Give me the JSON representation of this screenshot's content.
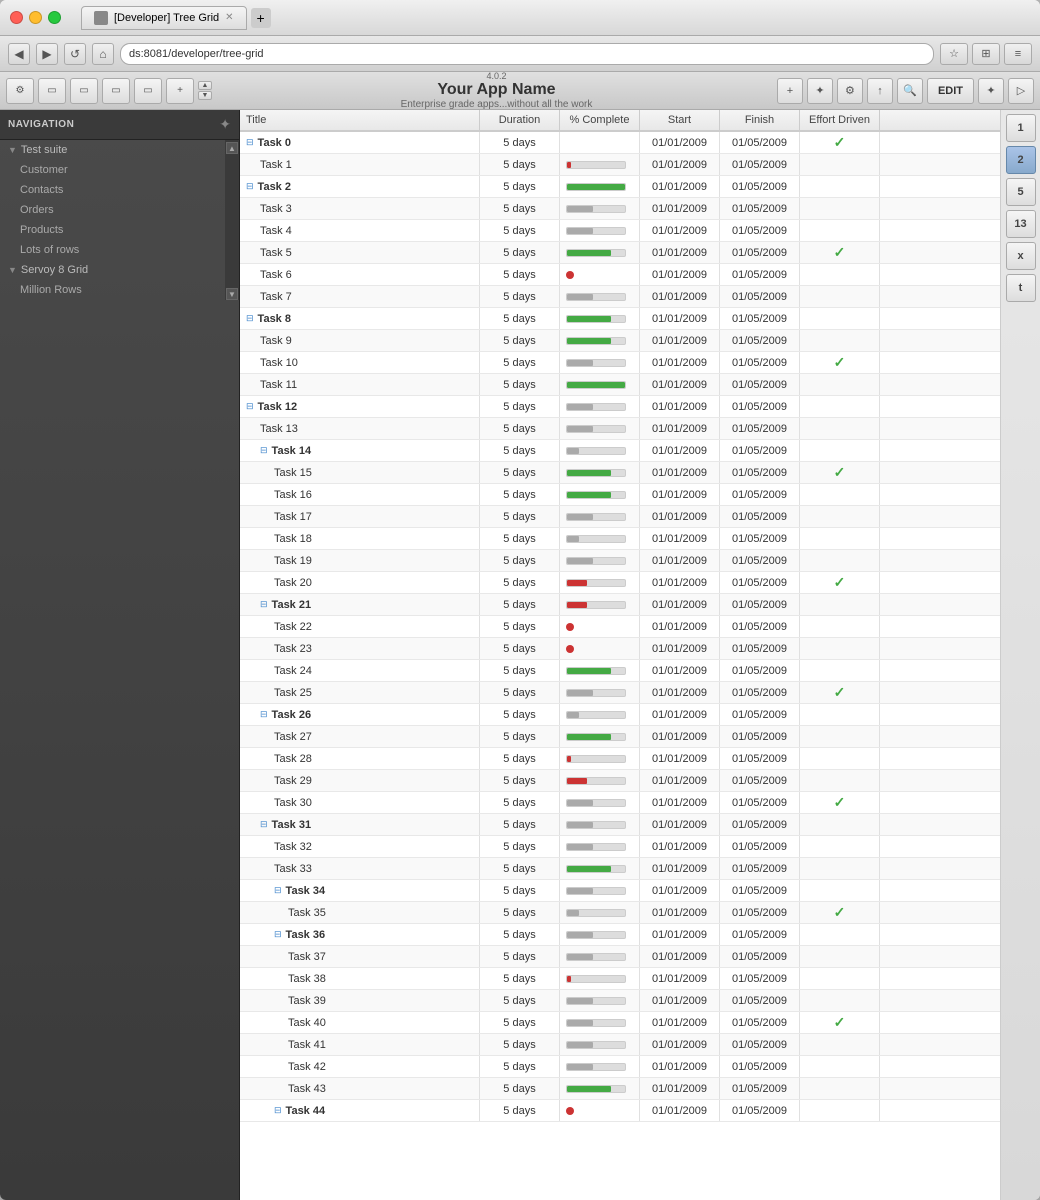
{
  "browser": {
    "tab_title": "[Developer] Tree Grid",
    "address": "ds:8081/developer/tree-grid",
    "new_tab_icon": "+"
  },
  "app": {
    "version": "4.0.2",
    "title": "Your App Name",
    "subtitle": "Enterprise grade apps...without all the work",
    "edit_button": "EDIT"
  },
  "nav": {
    "title": "NAVIGATION",
    "groups": [
      {
        "name": "Test suite",
        "items": [
          "Customer",
          "Contacts",
          "Orders",
          "Products",
          "Lots of rows"
        ]
      },
      {
        "name": "Servoy 8 Grid",
        "items": [
          "Million Rows"
        ]
      }
    ]
  },
  "grid": {
    "columns": [
      "Title",
      "Duration",
      "% Complete",
      "Start",
      "Finish",
      "Effort Driven"
    ],
    "rows": [
      {
        "title": "Task 0",
        "indent": 0,
        "expand": true,
        "duration": "5 days",
        "percent": "none",
        "start": "01/01/2009",
        "finish": "01/05/2009",
        "effort": "check"
      },
      {
        "title": "Task 1",
        "indent": 1,
        "expand": false,
        "duration": "5 days",
        "percent": "tiny-red",
        "start": "01/01/2009",
        "finish": "01/05/2009",
        "effort": ""
      },
      {
        "title": "Task 2",
        "indent": 0,
        "expand": true,
        "duration": "5 days",
        "percent": "full-green",
        "start": "01/01/2009",
        "finish": "01/05/2009",
        "effort": ""
      },
      {
        "title": "Task 3",
        "indent": 1,
        "expand": false,
        "duration": "5 days",
        "percent": "partial-gray",
        "start": "01/01/2009",
        "finish": "01/05/2009",
        "effort": ""
      },
      {
        "title": "Task 4",
        "indent": 1,
        "expand": false,
        "duration": "5 days",
        "percent": "partial-gray",
        "start": "01/01/2009",
        "finish": "01/05/2009",
        "effort": ""
      },
      {
        "title": "Task 5",
        "indent": 1,
        "expand": false,
        "duration": "5 days",
        "percent": "large-green",
        "start": "01/01/2009",
        "finish": "01/05/2009",
        "effort": "check"
      },
      {
        "title": "Task 6",
        "indent": 1,
        "expand": false,
        "duration": "5 days",
        "percent": "dot-red",
        "start": "01/01/2009",
        "finish": "01/05/2009",
        "effort": ""
      },
      {
        "title": "Task 7",
        "indent": 1,
        "expand": false,
        "duration": "5 days",
        "percent": "partial-gray",
        "start": "01/01/2009",
        "finish": "01/05/2009",
        "effort": ""
      },
      {
        "title": "Task 8",
        "indent": 0,
        "expand": true,
        "duration": "5 days",
        "percent": "large-green",
        "start": "01/01/2009",
        "finish": "01/05/2009",
        "effort": ""
      },
      {
        "title": "Task 9",
        "indent": 1,
        "expand": false,
        "duration": "5 days",
        "percent": "large-green",
        "start": "01/01/2009",
        "finish": "01/05/2009",
        "effort": ""
      },
      {
        "title": "Task 10",
        "indent": 1,
        "expand": false,
        "duration": "5 days",
        "percent": "partial-gray",
        "start": "01/01/2009",
        "finish": "01/05/2009",
        "effort": "check"
      },
      {
        "title": "Task 11",
        "indent": 1,
        "expand": false,
        "duration": "5 days",
        "percent": "full-green",
        "start": "01/01/2009",
        "finish": "01/05/2009",
        "effort": ""
      },
      {
        "title": "Task 12",
        "indent": 0,
        "expand": true,
        "duration": "5 days",
        "percent": "partial-gray",
        "start": "01/01/2009",
        "finish": "01/05/2009",
        "effort": ""
      },
      {
        "title": "Task 13",
        "indent": 1,
        "expand": false,
        "duration": "5 days",
        "percent": "partial-gray",
        "start": "01/01/2009",
        "finish": "01/05/2009",
        "effort": ""
      },
      {
        "title": "Task 14",
        "indent": 1,
        "expand": true,
        "duration": "5 days",
        "percent": "small-gray",
        "start": "01/01/2009",
        "finish": "01/05/2009",
        "effort": ""
      },
      {
        "title": "Task 15",
        "indent": 2,
        "expand": false,
        "duration": "5 days",
        "percent": "large-green",
        "start": "01/01/2009",
        "finish": "01/05/2009",
        "effort": "check"
      },
      {
        "title": "Task 16",
        "indent": 2,
        "expand": false,
        "duration": "5 days",
        "percent": "large-green",
        "start": "01/01/2009",
        "finish": "01/05/2009",
        "effort": ""
      },
      {
        "title": "Task 17",
        "indent": 2,
        "expand": false,
        "duration": "5 days",
        "percent": "partial-gray",
        "start": "01/01/2009",
        "finish": "01/05/2009",
        "effort": ""
      },
      {
        "title": "Task 18",
        "indent": 2,
        "expand": false,
        "duration": "5 days",
        "percent": "small-gray",
        "start": "01/01/2009",
        "finish": "01/05/2009",
        "effort": ""
      },
      {
        "title": "Task 19",
        "indent": 2,
        "expand": false,
        "duration": "5 days",
        "percent": "partial-gray",
        "start": "01/01/2009",
        "finish": "01/05/2009",
        "effort": ""
      },
      {
        "title": "Task 20",
        "indent": 2,
        "expand": false,
        "duration": "5 days",
        "percent": "medium-red",
        "start": "01/01/2009",
        "finish": "01/05/2009",
        "effort": "check"
      },
      {
        "title": "Task 21",
        "indent": 1,
        "expand": true,
        "duration": "5 days",
        "percent": "medium-red",
        "start": "01/01/2009",
        "finish": "01/05/2009",
        "effort": ""
      },
      {
        "title": "Task 22",
        "indent": 2,
        "expand": false,
        "duration": "5 days",
        "percent": "dot-red",
        "start": "01/01/2009",
        "finish": "01/05/2009",
        "effort": ""
      },
      {
        "title": "Task 23",
        "indent": 2,
        "expand": false,
        "duration": "5 days",
        "percent": "dot-red",
        "start": "01/01/2009",
        "finish": "01/05/2009",
        "effort": ""
      },
      {
        "title": "Task 24",
        "indent": 2,
        "expand": false,
        "duration": "5 days",
        "percent": "large-green",
        "start": "01/01/2009",
        "finish": "01/05/2009",
        "effort": ""
      },
      {
        "title": "Task 25",
        "indent": 2,
        "expand": false,
        "duration": "5 days",
        "percent": "partial-gray",
        "start": "01/01/2009",
        "finish": "01/05/2009",
        "effort": "check"
      },
      {
        "title": "Task 26",
        "indent": 1,
        "expand": true,
        "duration": "5 days",
        "percent": "small-gray",
        "start": "01/01/2009",
        "finish": "01/05/2009",
        "effort": ""
      },
      {
        "title": "Task 27",
        "indent": 2,
        "expand": false,
        "duration": "5 days",
        "percent": "large-green",
        "start": "01/01/2009",
        "finish": "01/05/2009",
        "effort": ""
      },
      {
        "title": "Task 28",
        "indent": 2,
        "expand": false,
        "duration": "5 days",
        "percent": "tiny-red",
        "start": "01/01/2009",
        "finish": "01/05/2009",
        "effort": ""
      },
      {
        "title": "Task 29",
        "indent": 2,
        "expand": false,
        "duration": "5 days",
        "percent": "medium-red",
        "start": "01/01/2009",
        "finish": "01/05/2009",
        "effort": ""
      },
      {
        "title": "Task 30",
        "indent": 2,
        "expand": false,
        "duration": "5 days",
        "percent": "partial-gray",
        "start": "01/01/2009",
        "finish": "01/05/2009",
        "effort": "check"
      },
      {
        "title": "Task 31",
        "indent": 1,
        "expand": true,
        "duration": "5 days",
        "percent": "partial-gray",
        "start": "01/01/2009",
        "finish": "01/05/2009",
        "effort": ""
      },
      {
        "title": "Task 32",
        "indent": 2,
        "expand": false,
        "duration": "5 days",
        "percent": "partial-gray",
        "start": "01/01/2009",
        "finish": "01/05/2009",
        "effort": ""
      },
      {
        "title": "Task 33",
        "indent": 2,
        "expand": false,
        "duration": "5 days",
        "percent": "large-green",
        "start": "01/01/2009",
        "finish": "01/05/2009",
        "effort": ""
      },
      {
        "title": "Task 34",
        "indent": 2,
        "expand": true,
        "duration": "5 days",
        "percent": "partial-gray",
        "start": "01/01/2009",
        "finish": "01/05/2009",
        "effort": ""
      },
      {
        "title": "Task 35",
        "indent": 3,
        "expand": false,
        "duration": "5 days",
        "percent": "small-gray",
        "start": "01/01/2009",
        "finish": "01/05/2009",
        "effort": "check"
      },
      {
        "title": "Task 36",
        "indent": 2,
        "expand": true,
        "duration": "5 days",
        "percent": "partial-gray",
        "start": "01/01/2009",
        "finish": "01/05/2009",
        "effort": ""
      },
      {
        "title": "Task 37",
        "indent": 3,
        "expand": false,
        "duration": "5 days",
        "percent": "partial-gray",
        "start": "01/01/2009",
        "finish": "01/05/2009",
        "effort": ""
      },
      {
        "title": "Task 38",
        "indent": 3,
        "expand": false,
        "duration": "5 days",
        "percent": "tiny-red",
        "start": "01/01/2009",
        "finish": "01/05/2009",
        "effort": ""
      },
      {
        "title": "Task 39",
        "indent": 3,
        "expand": false,
        "duration": "5 days",
        "percent": "partial-gray",
        "start": "01/01/2009",
        "finish": "01/05/2009",
        "effort": ""
      },
      {
        "title": "Task 40",
        "indent": 3,
        "expand": false,
        "duration": "5 days",
        "percent": "partial-gray",
        "start": "01/01/2009",
        "finish": "01/05/2009",
        "effort": "check"
      },
      {
        "title": "Task 41",
        "indent": 3,
        "expand": false,
        "duration": "5 days",
        "percent": "partial-gray",
        "start": "01/01/2009",
        "finish": "01/05/2009",
        "effort": ""
      },
      {
        "title": "Task 42",
        "indent": 3,
        "expand": false,
        "duration": "5 days",
        "percent": "partial-gray",
        "start": "01/01/2009",
        "finish": "01/05/2009",
        "effort": ""
      },
      {
        "title": "Task 43",
        "indent": 3,
        "expand": false,
        "duration": "5 days",
        "percent": "large-green",
        "start": "01/01/2009",
        "finish": "01/05/2009",
        "effort": ""
      },
      {
        "title": "Task 44",
        "indent": 2,
        "expand": true,
        "duration": "5 days",
        "percent": "dot-red",
        "start": "01/01/2009",
        "finish": "01/05/2009",
        "effort": ""
      }
    ]
  },
  "right_panel": {
    "buttons": [
      "1",
      "2",
      "5",
      "13",
      "x",
      "t"
    ]
  }
}
